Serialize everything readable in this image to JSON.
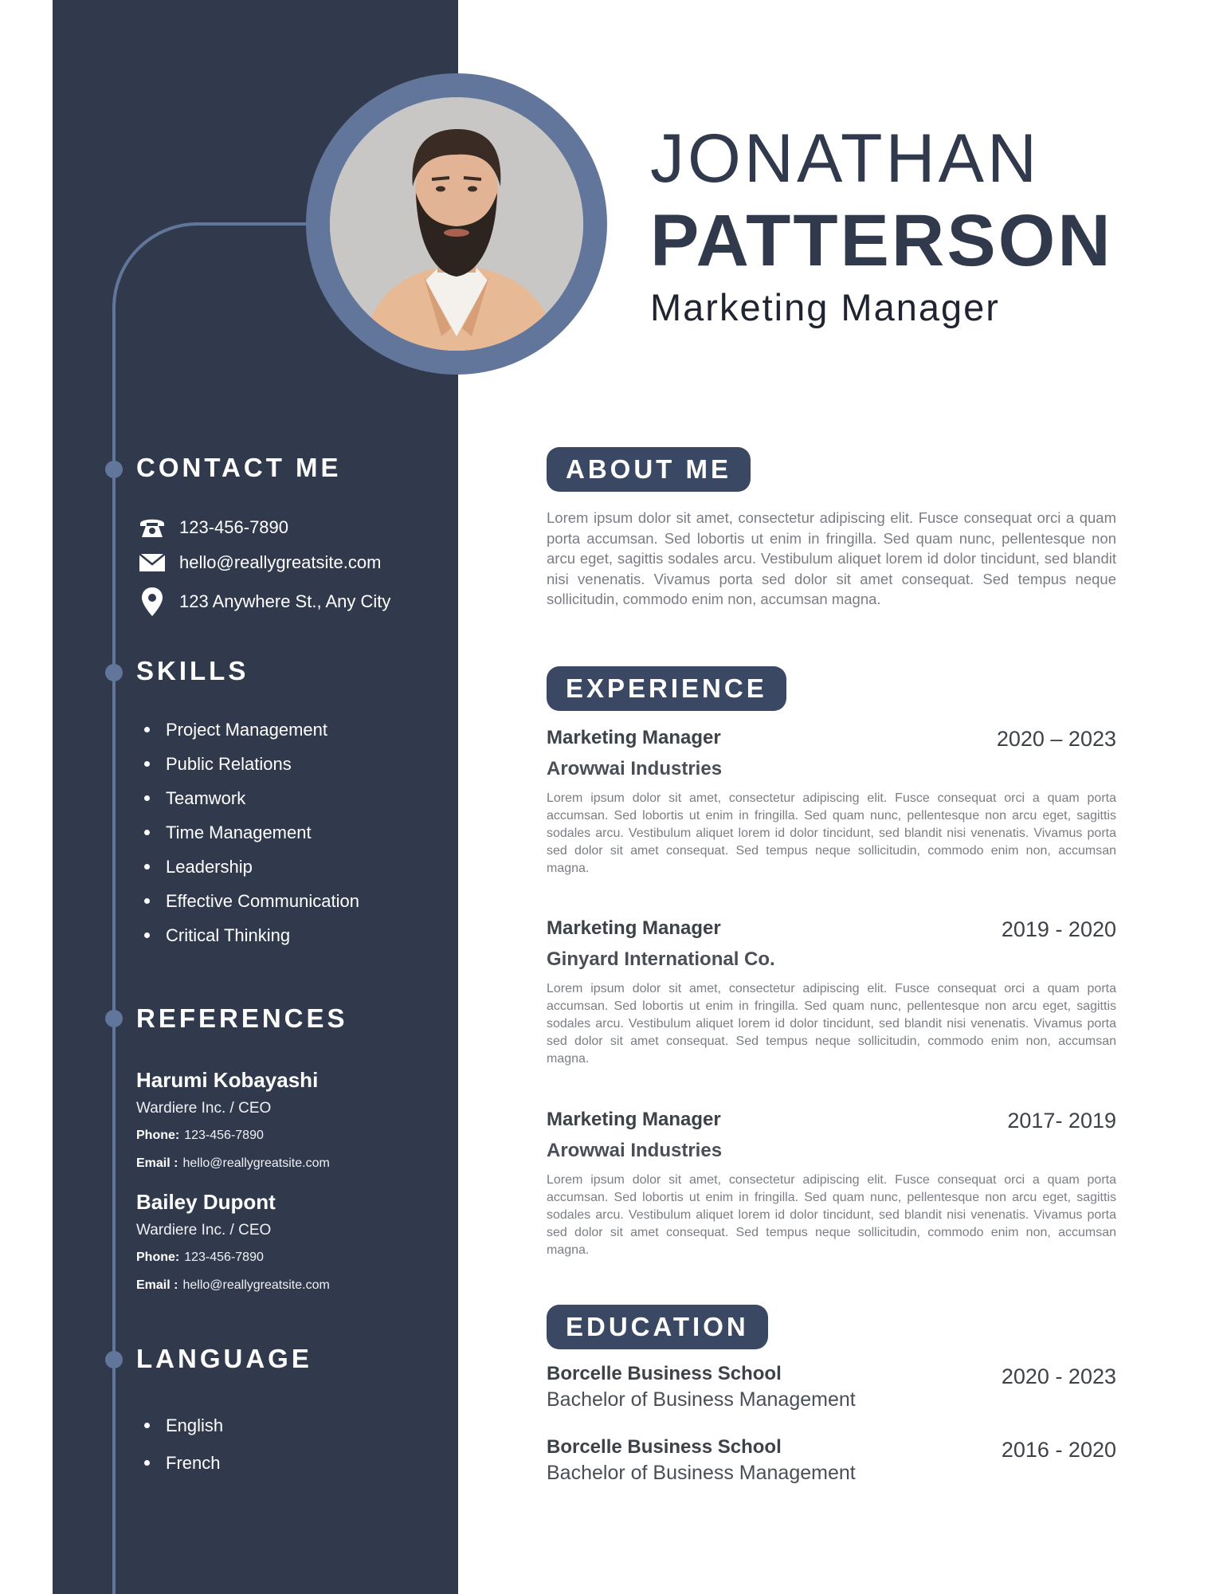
{
  "header": {
    "first_name": "JONATHAN",
    "last_name": "PATTERSON",
    "job_title": "Marketing Manager"
  },
  "contact": {
    "heading": "CONTACT ME",
    "phone": "123-456-7890",
    "email": "hello@reallygreatsite.com",
    "address": "123 Anywhere St., Any City",
    "icons": [
      "phone-icon",
      "mail-icon",
      "location-pin-icon"
    ]
  },
  "skills": {
    "heading": "SKILLS",
    "items": [
      "Project Management",
      "Public Relations",
      "Teamwork",
      "Time Management",
      "Leadership",
      "Effective Communication",
      "Critical Thinking"
    ]
  },
  "references": {
    "heading": "REFERENCES",
    "phone_label": "Phone:",
    "email_label": "Email :",
    "people": [
      {
        "name": "Harumi Kobayashi",
        "org": "Wardiere Inc. / CEO",
        "phone": "123-456-7890",
        "email": "hello@reallygreatsite.com"
      },
      {
        "name": "Bailey Dupont",
        "org": "Wardiere Inc. / CEO",
        "phone": "123-456-7890",
        "email": "hello@reallygreatsite.com"
      }
    ]
  },
  "language": {
    "heading": "LANGUAGE",
    "items": [
      "English",
      "French"
    ]
  },
  "about": {
    "heading": "ABOUT ME",
    "text": "Lorem ipsum dolor sit amet, consectetur adipiscing elit. Fusce consequat orci a quam porta accumsan. Sed lobortis ut enim in fringilla. Sed quam nunc, pellentesque non arcu eget, sagittis sodales arcu. Vestibulum aliquet lorem id dolor tincidunt, sed blandit nisi venenatis. Vivamus porta sed dolor sit amet consequat. Sed tempus neque sollicitudin, commodo enim non, accumsan magna."
  },
  "experience": {
    "heading": "EXPERIENCE",
    "jobs": [
      {
        "role": "Marketing Manager",
        "company": "Arowwai Industries",
        "dates": "2020 – 2023",
        "description": "Lorem ipsum dolor sit amet, consectetur adipiscing elit. Fusce consequat orci a quam porta accumsan. Sed lobortis ut enim in fringilla. Sed quam nunc, pellentesque non arcu eget, sagittis sodales arcu. Vestibulum aliquet lorem id dolor tincidunt, sed blandit nisi venenatis. Vivamus porta sed dolor sit amet consequat. Sed tempus neque sollicitudin, commodo enim non, accumsan magna."
      },
      {
        "role": "Marketing Manager",
        "company": "Ginyard International Co.",
        "dates": "2019 - 2020",
        "description": "Lorem ipsum dolor sit amet, consectetur adipiscing elit. Fusce consequat orci a quam porta accumsan. Sed lobortis ut enim in fringilla. Sed quam nunc, pellentesque non arcu eget, sagittis sodales arcu. Vestibulum aliquet lorem id dolor tincidunt, sed blandit nisi venenatis. Vivamus porta sed dolor sit amet consequat. Sed tempus neque sollicitudin, commodo enim non, accumsan magna."
      },
      {
        "role": "Marketing Manager",
        "company": "Arowwai Industries",
        "dates": "2017- 2019",
        "description": "Lorem ipsum dolor sit amet, consectetur adipiscing elit. Fusce consequat orci a quam porta accumsan. Sed lobortis ut enim in fringilla. Sed quam nunc, pellentesque non arcu eget, sagittis sodales arcu. Vestibulum aliquet lorem id dolor tincidunt, sed blandit nisi venenatis. Vivamus porta sed dolor sit amet consequat. Sed tempus neque sollicitudin, commodo enim non, accumsan magna."
      }
    ]
  },
  "education": {
    "heading": "EDUCATION",
    "entries": [
      {
        "school": "Borcelle Business School",
        "degree": "Bachelor of Business Management",
        "dates": "2020 - 2023"
      },
      {
        "school": "Borcelle Business School",
        "degree": "Bachelor of Business Management",
        "dates": "2016 - 2020"
      }
    ]
  },
  "colors": {
    "sidebar": "#313a4c",
    "accent": "#62769b",
    "pill": "#3b4863"
  }
}
